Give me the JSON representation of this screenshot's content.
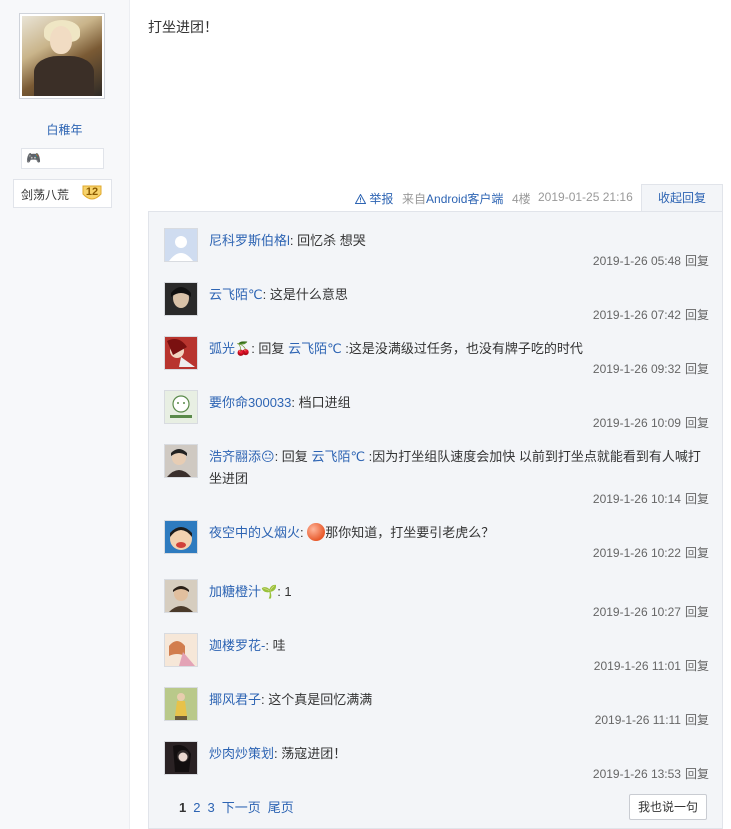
{
  "author": {
    "username": "白稚年",
    "level_name": "剑荡八荒",
    "level": "12",
    "badge_icon": "gamepad-icon"
  },
  "post": {
    "content": "打坐进团！",
    "report_label": "举报",
    "from_prefix": "来自",
    "client": "Android客户端",
    "floor": "4楼",
    "time": "2019-01-25 21:16",
    "collapse_label": "收起回复"
  },
  "replies": [
    {
      "name": "尼科罗斯伯格l",
      "content": "回忆杀 想哭",
      "time": "2019-1-26 05:48",
      "reply_label": "回复",
      "avatar_color": "#cfdcf0"
    },
    {
      "name": "云飞陌℃",
      "content": "这是什么意思",
      "time": "2019-1-26 07:42",
      "reply_label": "回复",
      "avatar_color": "#2a2a2a"
    },
    {
      "name": "弧光🍒",
      "reply_word": "回复",
      "at": "云飞陌℃",
      "content": ":这是没满级过任务，也没有牌子吃的时代",
      "time": "2019-1-26 09:32",
      "reply_label": "回复",
      "avatar_color": "#b8342e"
    },
    {
      "name": "要你命300033",
      "content": "档口进组",
      "time": "2019-1-26 10:09",
      "reply_label": "回复",
      "avatar_color": "#e8efe3"
    },
    {
      "name": "浩齐翮添😐",
      "reply_word": "回复",
      "at": "云飞陌℃",
      "content": ":因为打坐组队速度会加快 以前到打坐点就能看到有人喊打坐进团",
      "time": "2019-1-26 10:14",
      "reply_label": "回复",
      "avatar_color": "#5a4a44"
    },
    {
      "name": "夜空中的乂烟火",
      "content": "那你知道，打坐要引老虎么？",
      "time": "2019-1-26 10:22",
      "reply_label": "回复",
      "avatar_color": "#2e7bbf"
    },
    {
      "name": "加糖橙汁🌱",
      "content": "1",
      "time": "2019-1-26 10:27",
      "reply_label": "回复",
      "avatar_color": "#b9a48c"
    },
    {
      "name": "迦楼罗花-",
      "content": "哇",
      "time": "2019-1-26 11:01",
      "reply_label": "回复",
      "avatar_color": "#f0c7a8"
    },
    {
      "name": "揶风君子",
      "content": "这个真是回忆满满",
      "time": "2019-1-26 11:11",
      "reply_label": "回复",
      "avatar_color": "#8fa75a"
    },
    {
      "name": "炒肉炒策划",
      "content": "荡寇进团！",
      "time": "2019-1-26 13:53",
      "reply_label": "回复",
      "avatar_color": "#3a2c2e"
    }
  ],
  "pager": {
    "pages": [
      "1",
      "2",
      "3"
    ],
    "next": "下一页",
    "last": "尾页"
  },
  "say_button": "我也说一句"
}
